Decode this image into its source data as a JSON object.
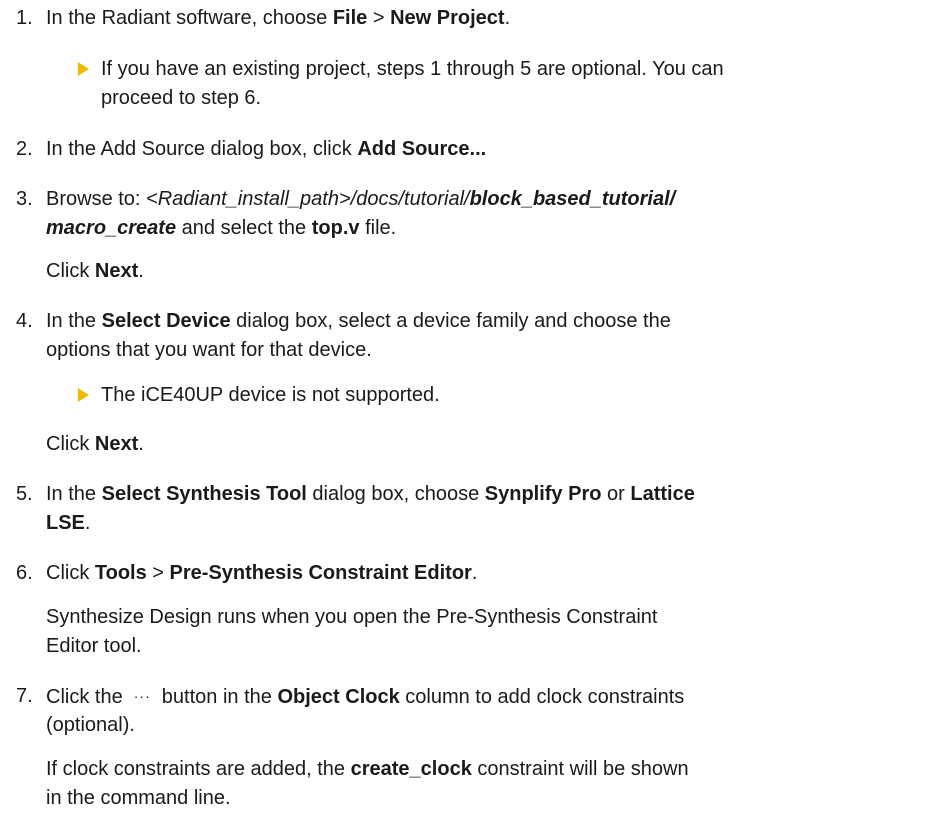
{
  "steps": {
    "s1": {
      "num": "1.",
      "a": "In the Radiant software, choose ",
      "b": "File",
      "c": " > ",
      "d": "New Project",
      "e": ".",
      "note_l1": "If you have an existing project, steps 1 through 5 are optional. You can",
      "note_l2": "proceed to step 6."
    },
    "s2": {
      "num": "2.",
      "a": "In the Add Source dialog box, click ",
      "b": "Add Source..."
    },
    "s3": {
      "num": "3.",
      "a": "Browse to: ",
      "b": "<Radiant_install_path>/docs/tutorial/",
      "c": "block_based_tutorial/",
      "d": "macro_create",
      "e": " and select the ",
      "f": "top.v",
      "g": " file.",
      "click": "Click ",
      "next": "Next",
      "dot": "."
    },
    "s4": {
      "num": "4.",
      "a": "In the ",
      "b": "Select Device",
      "c": " dialog box, select a device family and choose the",
      "l2": "options that you want for that device.",
      "note": "The iCE40UP device is not supported.",
      "click": "Click ",
      "next": "Next",
      "dot": "."
    },
    "s5": {
      "num": "5.",
      "a": "In the ",
      "b": "Select Synthesis Tool",
      "c": " dialog box, choose ",
      "d": "Synplify Pro",
      "e": " or ",
      "f": "Lattice",
      "g": "LSE",
      "h": "."
    },
    "s6": {
      "num": "6.",
      "a": "Click ",
      "b": "Tools",
      "c": " > ",
      "d": "Pre-Synthesis Constraint Editor",
      "e": ".",
      "p1": "Synthesize Design runs when you open the Pre-Synthesis Constraint",
      "p2": "Editor tool."
    },
    "s7": {
      "num": "7.",
      "a": "Click the ",
      "btn": "···",
      "b": " button in the ",
      "c": "Object Clock",
      "d": " column to add clock constraints",
      "l2": "(optional).",
      "p_a": "If clock constraints are added, the ",
      "p_b": "create_clock",
      "p_c": " constraint will be shown",
      "p2": "in the command line."
    }
  },
  "colors": {
    "text": "#1a1a1a",
    "note_arrow": "#f5b800"
  },
  "icons": {
    "note": "note-arrow-icon"
  }
}
